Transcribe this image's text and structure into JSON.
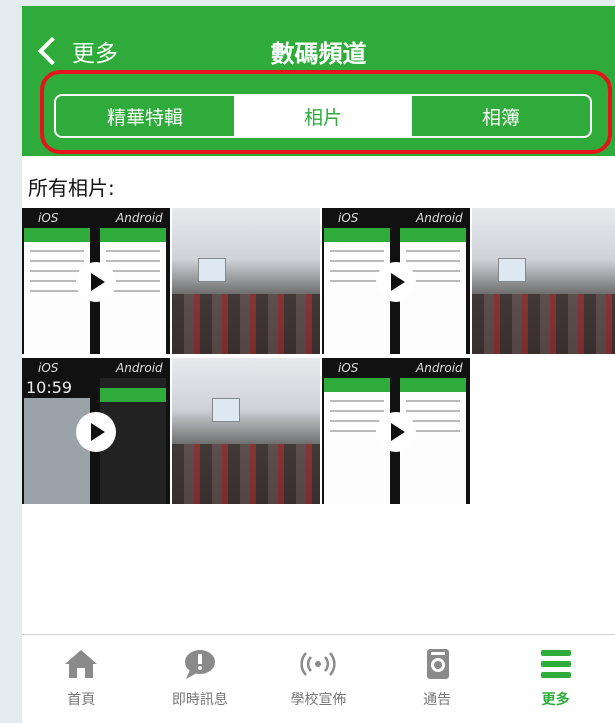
{
  "header": {
    "back_label": "更多",
    "title": "數碼頻道"
  },
  "tabs": [
    {
      "label": "精華特輯",
      "active": false
    },
    {
      "label": "相片",
      "active": true
    },
    {
      "label": "相簿",
      "active": false
    }
  ],
  "section_title": "所有相片:",
  "gallery": [
    {
      "type": "video",
      "ios_label": "iOS",
      "android_label": "Android"
    },
    {
      "type": "photo"
    },
    {
      "type": "video",
      "ios_label": "iOS",
      "android_label": "Android"
    },
    {
      "type": "photo"
    },
    {
      "type": "video",
      "ios_label": "iOS",
      "android_label": "Android",
      "time": "10:59"
    },
    {
      "type": "photo"
    },
    {
      "type": "video",
      "ios_label": "iOS",
      "android_label": "Android"
    }
  ],
  "bottom_nav": [
    {
      "label": "首頁",
      "icon": "home-icon"
    },
    {
      "label": "即時訊息",
      "icon": "message-alert-icon"
    },
    {
      "label": "學校宣佈",
      "icon": "broadcast-icon"
    },
    {
      "label": "通告",
      "icon": "notice-icon"
    },
    {
      "label": "更多",
      "icon": "menu-icon",
      "active": true
    }
  ],
  "colors": {
    "brand_green": "#2eab3a",
    "highlight_red": "#e4141a"
  }
}
